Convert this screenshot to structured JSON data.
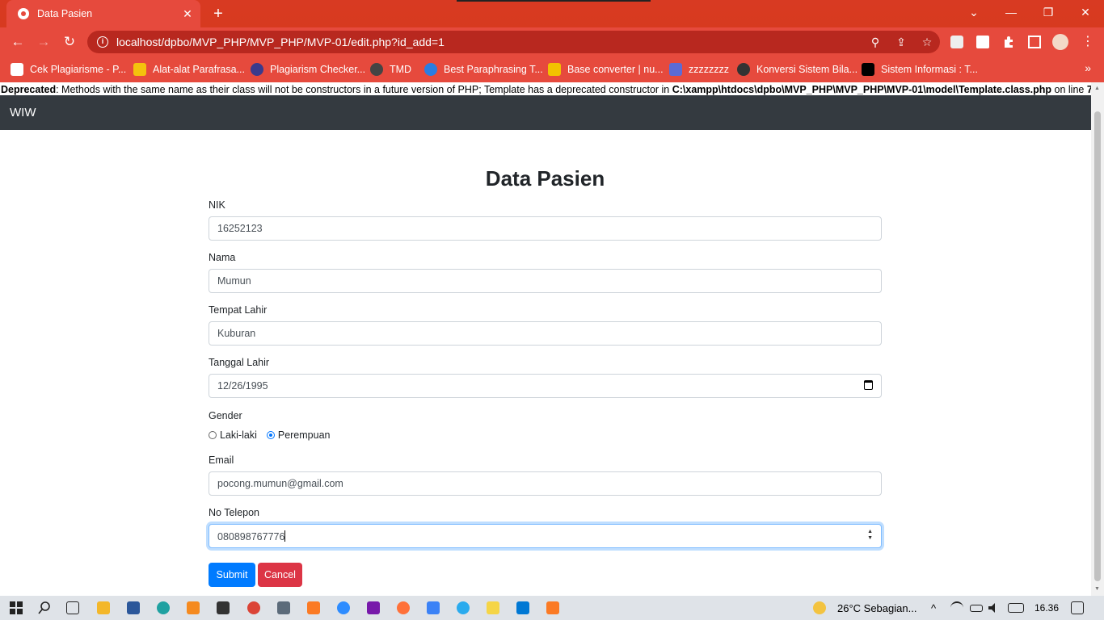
{
  "browser": {
    "tab_title": "Data Pasien",
    "tab_close": "✕",
    "new_tab": "+",
    "url": "localhost/dpbo/MVP_PHP/MVP_PHP/MVP-01/edit.php?id_add=1",
    "window_controls": {
      "dropdown": "⌄",
      "minimize": "—",
      "restore": "❐",
      "close": "✕"
    },
    "nav": {
      "back": "←",
      "forward": "→",
      "reload": "↻"
    },
    "omni_icons": {
      "zoom": "⚲",
      "share": "⇪",
      "star": "☆"
    },
    "bookmarks": [
      {
        "label": "Cek Plagiarisme - P...",
        "icon_color": "#ffffff"
      },
      {
        "label": "Alat-alat Parafrasa...",
        "icon_color": "#f4c20d"
      },
      {
        "label": "Plagiarism Checker...",
        "icon_color": "#3a3a8c"
      },
      {
        "label": "TMD",
        "icon_color": "#444444"
      },
      {
        "label": "Best Paraphrasing T...",
        "icon_color": "#2a7de1"
      },
      {
        "label": "Base converter | nu...",
        "icon_color": "#f2c200"
      },
      {
        "label": "zzzzzzzz",
        "icon_color": "#5b6bd6"
      },
      {
        "label": "Konversi Sistem Bila...",
        "icon_color": "#333333"
      },
      {
        "label": "Sistem Informasi : T...",
        "icon_color": "#000000"
      }
    ],
    "bookmarks_more": "»"
  },
  "page": {
    "deprecated_label": "Deprecated",
    "deprecated_text": ": Methods with the same name as their class will not be constructors in a future version of PHP; Template has a deprecated constructor in ",
    "deprecated_path": "C:\\xampp\\htdocs\\dpbo\\MVP_PHP\\MVP_PHP\\MVP-01\\model\\Template.class.php",
    "deprecated_online": " on line ",
    "deprecated_line": "7",
    "brand": "WIW",
    "title": "Data Pasien",
    "form": {
      "nik_label": "NIK",
      "nik_value": "16252123",
      "nama_label": "Nama",
      "nama_value": "Mumun",
      "tempat_label": "Tempat Lahir",
      "tempat_value": "Kuburan",
      "tanggal_label": "Tanggal Lahir",
      "tanggal_value": "12/26/1995",
      "gender_label": "Gender",
      "gender_options": [
        "Laki-laki",
        "Perempuan"
      ],
      "gender_selected": "Perempuan",
      "email_label": "Email",
      "email_value": "pocong.mumun@gmail.com",
      "telepon_label": "No Telepon",
      "telepon_value": "080898767776",
      "submit_label": "Submit",
      "cancel_label": "Cancel"
    }
  },
  "taskbar": {
    "weather": "26°C  Sebagian...",
    "time": "16.36",
    "caret_up": "^"
  },
  "colors": {
    "browser_red": "#e64a3d",
    "navbar": "#343a40",
    "primary": "#007bff",
    "danger": "#dc3545"
  }
}
